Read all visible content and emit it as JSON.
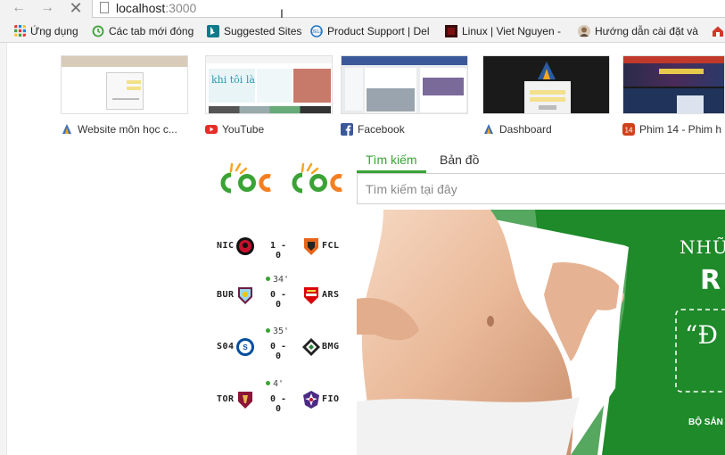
{
  "browser": {
    "url_host": "localhost",
    "url_port": ":3000",
    "nav": {
      "back": "←",
      "forward": "→",
      "stop": "✕"
    },
    "cursor_glyph": "I"
  },
  "bookmarks": [
    {
      "label": "Ứng dụng",
      "icon": "apps-grid-icon",
      "color": "#e53935"
    },
    {
      "label": "Các tab mới đóng",
      "icon": "history-icon",
      "color": "#3aa335"
    },
    {
      "label": "Suggested Sites",
      "icon": "bing-icon",
      "color": "#0f7b8a"
    },
    {
      "label": "Product Support | Del",
      "icon": "dell-icon",
      "color": "#1a73c8"
    },
    {
      "label": "Linux | Viet Nguyen -",
      "icon": "linux-site-icon",
      "color": "#7a1010"
    },
    {
      "label": "Hướng dẫn cài đặt và",
      "icon": "avatar-icon",
      "color": "#8a6a4a"
    },
    {
      "label": "",
      "icon": "home-icon",
      "color": "#d03a2a"
    }
  ],
  "tiles": [
    {
      "label": "Website môn học c...",
      "icon": "site-logo-icon",
      "icon_color": "#3b6fb6"
    },
    {
      "label": "YouTube",
      "icon": "youtube-icon",
      "icon_color": "#e52d27"
    },
    {
      "label": "Facebook",
      "icon": "facebook-icon",
      "icon_color": "#3b5998"
    },
    {
      "label": "Dashboard",
      "icon": "dashboard-icon",
      "icon_color": "#3b6fb6"
    },
    {
      "label": "Phim 14 - Phim h",
      "icon": "phim14-icon",
      "icon_color": "#d0421b"
    }
  ],
  "thumbs": {
    "t2_text": "khi tôi là tôi"
  },
  "search": {
    "tabs": [
      "Tìm kiếm",
      "Bản đồ"
    ],
    "active_tab": 0,
    "placeholder": "Tìm kiếm tại đây",
    "accent": "#3aa335"
  },
  "logo": {
    "text": "cốc cốc",
    "colors": [
      "#3aa335",
      "#f57f20"
    ]
  },
  "matches": [
    {
      "home": "NIC",
      "away": "FCL",
      "score": "1 - 0",
      "minute": "",
      "home_color": "#c8102e",
      "away_color": "#e8641b"
    },
    {
      "home": "BUR",
      "away": "ARS",
      "score": "0 - 0",
      "minute": "34'",
      "home_color": "#6c1d45",
      "away_color": "#db0007"
    },
    {
      "home": "S04",
      "away": "BMG",
      "score": "0 - 0",
      "minute": "35'",
      "home_color": "#004d9d",
      "away_color": "#222222"
    },
    {
      "home": "TOR",
      "away": "FIO",
      "score": "0 - 0",
      "minute": "4'",
      "home_color": "#8a1538",
      "away_color": "#4b2a84"
    }
  ],
  "ad": {
    "line1": "NHỮ",
    "line2": "R",
    "line3": "“Đ",
    "line4": "BỘ SẢN",
    "green": "#1e8a2a"
  }
}
